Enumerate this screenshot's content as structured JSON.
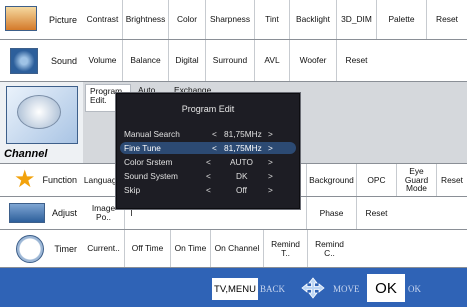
{
  "categories": [
    {
      "label": "Picture",
      "icon": "picture-icon"
    },
    {
      "label": "Sound",
      "icon": "speaker-icon"
    },
    {
      "label": "Channel",
      "icon": "satellite-dish-icon"
    },
    {
      "label": "Function",
      "icon": "star-function-icon"
    },
    {
      "label": "Adjust",
      "icon": "adjust-screen-icon"
    },
    {
      "label": "Timer",
      "icon": "clock-icon"
    }
  ],
  "picture_items": [
    "Contrast",
    "Brightness",
    "Color",
    "Sharpness",
    "Tint",
    "Backlight",
    "3D_DIM",
    "Palette",
    "Reset"
  ],
  "sound_items": [
    "Volume",
    "Balance",
    "Digital",
    "Surround",
    "AVL",
    "Woofer",
    "Reset"
  ],
  "channel_tabs": [
    "Program\nEdit.",
    "Auto\nT..",
    "Exchange"
  ],
  "function_items": [
    "Language",
    "M",
    "Background",
    "OPC",
    "Eye Guard\nMode",
    "Reset"
  ],
  "adjust_items": [
    "Image Po..",
    "I",
    "Phase",
    "Reset"
  ],
  "timer_items": [
    "Current..",
    "Off Time",
    "On Time",
    "On Channel",
    "Remind T..",
    "Remind C.."
  ],
  "popup": {
    "title": "Program Edit",
    "rows": [
      {
        "label": "Manual Search",
        "left": "<",
        "value": "81,75MHz",
        "right": ">"
      },
      {
        "label": "Fine Tune",
        "left": "<",
        "value": "81,75MHz",
        "right": ">"
      },
      {
        "label": "Color Srstem",
        "left": "<",
        "value": "AUTO",
        "right": ">"
      },
      {
        "label": "Sound System",
        "left": "<",
        "value": "DK",
        "right": ">"
      },
      {
        "label": "Skip",
        "left": "<",
        "value": "Off",
        "right": ">"
      }
    ]
  },
  "bottom": {
    "tv_menu": "TV,MENU",
    "back": "BACK",
    "move": "MOVE",
    "ok_key": "OK",
    "ok": "OK"
  },
  "colors": {
    "bottom_bar": "#2f63b6",
    "popup_bg": "#1d1d24",
    "highlight": "#2c4a73"
  }
}
